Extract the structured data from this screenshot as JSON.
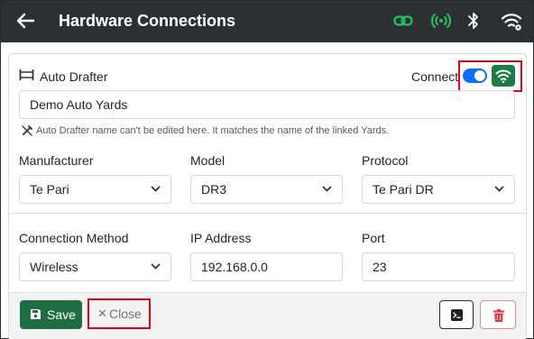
{
  "header": {
    "title": "Hardware Connections",
    "icons": [
      "back-arrow-icon",
      "link-icon",
      "signal-icon",
      "bluetooth-icon",
      "wifi-icon"
    ]
  },
  "device": {
    "type_label": "Auto Drafter",
    "connect_label": "Connect",
    "connected": true,
    "name_value": "Demo Auto Yards",
    "name_hint": "Auto Drafter name can't be edited here. It matches the name of the linked Yards."
  },
  "fields": {
    "manufacturer": {
      "label": "Manufacturer",
      "value": "Te Pari"
    },
    "model": {
      "label": "Model",
      "value": "DR3"
    },
    "protocol": {
      "label": "Protocol",
      "value": "Te Pari DR"
    },
    "connection_method": {
      "label": "Connection Method",
      "value": "Wireless"
    },
    "ip_address": {
      "label": "IP Address",
      "value": "192.168.0.0"
    },
    "port": {
      "label": "Port",
      "value": "23"
    }
  },
  "footer": {
    "save_label": "Save",
    "close_label": "Close"
  },
  "colors": {
    "header_bg": "#2d3033",
    "status_green": "#22c55e",
    "toggle_blue": "#0d6efd",
    "save_green": "#1e6e43",
    "highlight_red": "#e0001b",
    "delete_red": "#dc3545"
  }
}
